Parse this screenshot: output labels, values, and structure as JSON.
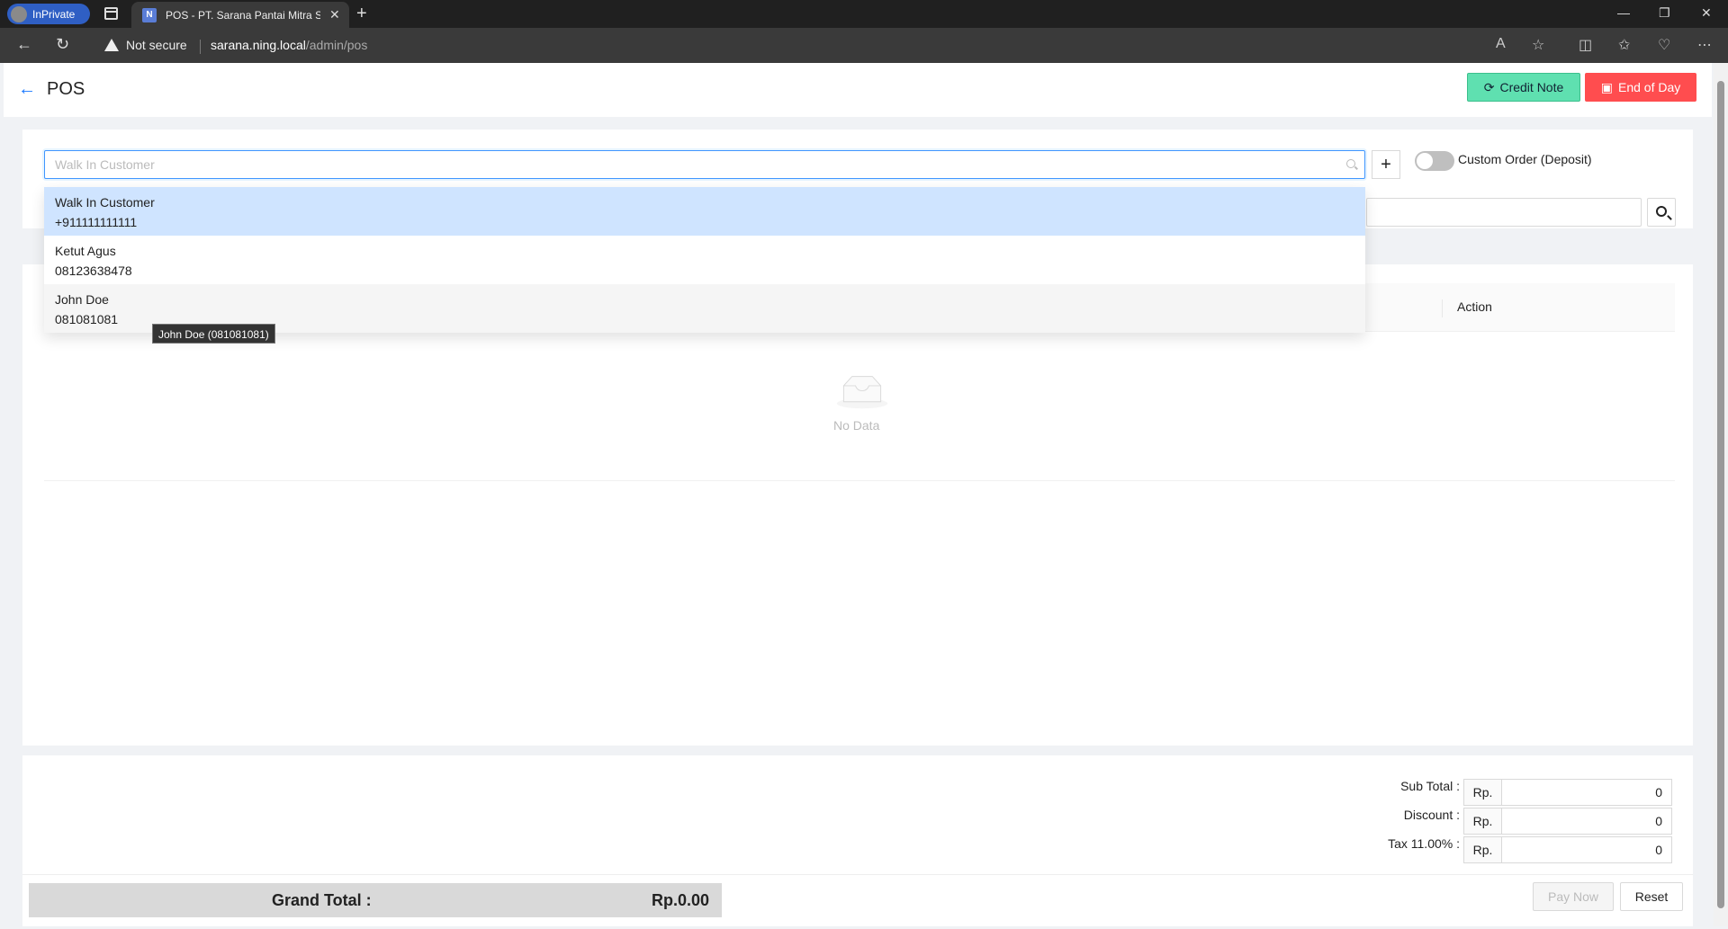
{
  "browser": {
    "inprivate_label": "InPrivate",
    "tab_title": "POS - PT. Sarana Pantai Mitra Se...",
    "security_label": "Not secure",
    "url_host": "sarana.ning.local",
    "url_path": "/admin/pos"
  },
  "header": {
    "title": "POS",
    "credit_note_label": "Credit Note",
    "end_of_day_label": "End of Day"
  },
  "customer": {
    "placeholder": "Walk In Customer",
    "custom_order_label": "Custom Order (Deposit)",
    "options": [
      {
        "name": "Walk In Customer",
        "phone": "+911111111111"
      },
      {
        "name": "Ketut Agus",
        "phone": "08123638478"
      },
      {
        "name": "John Doe",
        "phone": "081081081"
      }
    ],
    "tooltip": "John Doe (081081081)"
  },
  "table": {
    "action_header": "Action",
    "empty_text": "No Data"
  },
  "summary": {
    "subtotal_label": "Sub Total :",
    "discount_label": "Discount :",
    "tax_label": "Tax 11.00% :",
    "currency_prefix": "Rp.",
    "subtotal_value": "0",
    "discount_value": "0",
    "tax_value": "0",
    "grand_total_label": "Grand Total :",
    "grand_total_value": "Rp.0.00",
    "pay_now_label": "Pay Now",
    "reset_label": "Reset"
  }
}
